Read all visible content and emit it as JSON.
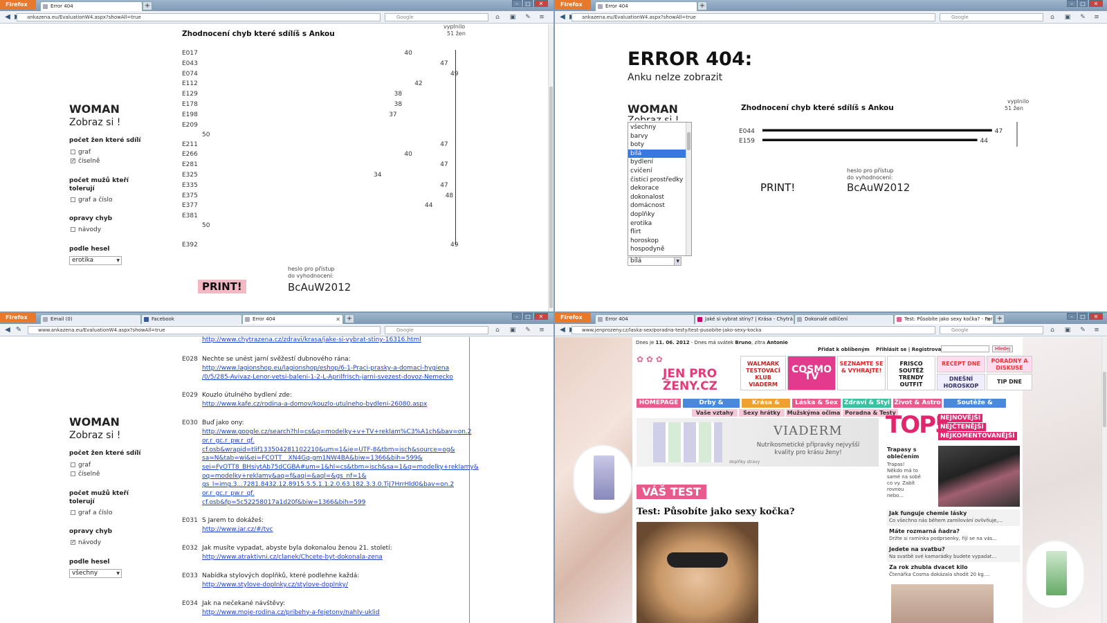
{
  "browser": {
    "ff_label": "Firefox",
    "tab_error": "Error 404",
    "tab_email": "Email (0)",
    "tab_facebook": "Facebook",
    "tab_jaky": "Jaké si vybrat stíny? | Krása - Chytrá ž...",
    "tab_dokonale": "Dokonalé odlíčení",
    "tab_test": "Test: Působíte jako sexy kočka? - Pora...",
    "url_anka": "ankazena.eu/EvaluationW4.aspx?showAll=true",
    "url_anka_www": "www.ankazena.eu/EvaluationW4.aspx?showAll=true",
    "url_jen": "www.jenprozeny.cz/laska-sex/poradna-testy/test-pusobite-jako-sexy-kocka",
    "search_engine": "Google"
  },
  "sidebar": {
    "woman": "WOMAN",
    "zobraz": "Zobraz si !",
    "pocet_zen": "počet žen které sdílí",
    "graf": "graf",
    "ciselne": "číselně",
    "pocet_muzu": "počet mužů kteří",
    "toleruji": "tolerují",
    "graf_cislo": "graf a číslo",
    "opravy": "opravy chyb",
    "navody": "návody",
    "podle_hesel": "podle hesel",
    "select_q1": "erotika",
    "select_q3": "všechny"
  },
  "q1": {
    "title": "Zhodnocení chyb které sdílíš s Ankou",
    "vyplnilo": "vyplnilo",
    "zen": "51 žen",
    "rows": [
      {
        "code": "E017",
        "value": "40"
      },
      {
        "code": "E043",
        "value": "47"
      },
      {
        "code": "E074",
        "value": "49"
      },
      {
        "code": "E112",
        "value": "42"
      },
      {
        "code": "E129",
        "value": "38"
      },
      {
        "code": "E178",
        "value": "38"
      },
      {
        "code": "E198",
        "value": "37"
      },
      {
        "code": "E209",
        "value": "50"
      },
      {
        "code": "E211",
        "value": "47"
      },
      {
        "code": "E266",
        "value": "40"
      },
      {
        "code": "E281",
        "value": "47"
      },
      {
        "code": "E325",
        "value": "34"
      },
      {
        "code": "E335",
        "value": "47"
      },
      {
        "code": "E375",
        "value": "48"
      },
      {
        "code": "E377",
        "value": "44"
      },
      {
        "code": "E381",
        "value": "50"
      },
      {
        "code": "E392",
        "value": "49"
      }
    ],
    "print": "PRINT!",
    "heslo1": "heslo pro přístup",
    "heslo2": "do vyhodnocení:",
    "password": "BcAuW2012"
  },
  "q2": {
    "error": "ERROR 404:",
    "error_sub": "Anku nelze zobrazit",
    "woman": "WOMAN",
    "zobraz_partial": "Zobraz si !",
    "title": "Zhodnocení chyb které sdílíš s Ankou",
    "vyplnilo": "vyplnilo",
    "zen": "51 žen",
    "chart_data": {
      "type": "bar",
      "orientation": "horizontal",
      "categories": [
        "E044",
        "E159"
      ],
      "values": [
        47,
        44
      ],
      "xlim": [
        0,
        51
      ]
    },
    "listbox": [
      "všechny",
      "barvy",
      "boty",
      "bílá",
      "bydlení",
      "cvičení",
      "čisticí prostředky",
      "dekorace",
      "dokonalost",
      "domácnost",
      "doplňky",
      "erotika",
      "flirt",
      "horoskop",
      "hospodyně"
    ],
    "listbox_selected": "bílá",
    "select_value": "bílá",
    "print": "PRINT!",
    "heslo1": "heslo pro přístup",
    "heslo2": "do vyhodnocení:",
    "password": "BcAuW2012"
  },
  "q3": {
    "top_link": "http://www.chytrazena.cz/zdravi/krasa/jake-si-vybrat-stiny-16316.html",
    "items": [
      {
        "code": "E028",
        "text": "Nechte se unést jarní svěžestí dubnového rána:",
        "links": [
          "http://www.lagionshop.eu/lagionshop/eshop/6-1-Praci-prasky-a-domaci-hygiena",
          "/0/5/285-Avivaz-Lenor-vetsi-baleni-1-2-L-Aprilfrisch-jarni-svezest-dovoz-Nemecko"
        ]
      },
      {
        "code": "E029",
        "text": "Kouzlo útulného bydlení zde:",
        "links": [
          "http://www.kafe.cz/rodina-a-domov/kouzlo-utulneho-bydleni-26080.aspx"
        ]
      },
      {
        "code": "E030",
        "text": "Buď jako ony:",
        "links": [
          "http://www.google.cz/search?hl=cs&q=modelky+v+TV+reklam%C3%A1ch&bav=on.2",
          "or.r_gc.r_pw.r_qf.",
          "cf.osb&wrapid=tlif133504281102210&um=1&ie=UTF-8&tbm=isch&source=og&",
          "sa=N&tab=wi&ei=FCOTT__XN4Gq-gm1NW4BA&biw=1366&bih=599&",
          "sei=FyOTT8_BHsiytAb75dCGBA#um=1&hl=cs&tbm=isch&sa=1&q=modelky+reklamy&",
          "oq=modelky+reklamy&aq=f&aqi=&aql=&gs_nf=1&",
          "gs_l=img.3...7281.8432.12.8915.5.5.1.1.2.0.63.182.3.3.0.TiJ7HrrHld0&bav=on.2",
          "or.r_gc.r_pw.r_qf.",
          "cf.osb&fp=5c52258017a1d20f&biw=1366&bih=599"
        ]
      },
      {
        "code": "E031",
        "text": "S Jarem to dokážeš:",
        "links": [
          "http://www.jar.cz/#/tvc"
        ]
      },
      {
        "code": "E032",
        "text": "Jak musíte vypadat, abyste byla dokonalou ženou 21. století:",
        "links": [
          "http://www.atraktivni.cz/clanek/Chcete-byt-dokonala-zena"
        ]
      },
      {
        "code": "E033",
        "text": "Nabídka stylových doplňků, které podlehne každá:",
        "links": [
          "http://www.stylove-doplnky.cz/stylove-doplnky/"
        ]
      },
      {
        "code": "E034",
        "text": "Jak na nečekané návštěvy:",
        "links": [
          "http://www.moje-rodina.cz/pribehy-a-fejetony/nahly-uklid"
        ]
      }
    ]
  },
  "q4": {
    "date_prefix": "Dnes je",
    "date": "11. 06. 2012",
    "date_mid": "- Dnes má svátek",
    "svatek": "Bruno",
    "zitra": ", zítra",
    "zitra_name": "Antonie",
    "pridat": "Přidat k oblíbeným",
    "prihlasit": "Přihlásit se | Registrovat",
    "hledej": "Hledej",
    "logo1": "JEN PRO",
    "logo2": "ŽENY.CZ",
    "ads": [
      "WALMARK TESTOVACÍ KLUB VIADERM",
      "COSMO TV",
      "SEZNAMTE SE & VYHRAJTE!",
      "FRISCO SOUTĚŽ TRENDY OUTFIT",
      "RECEPT DNE",
      "PORADNY A DISKUSE",
      "DNEŠNÍ HOROSKOP",
      "TIP DNE"
    ],
    "nav": [
      "HOMEPAGE",
      "Drby & Celebrity",
      "Krása & Móda",
      "Láska & Sex",
      "Zdraví & Styl",
      "Život & Astro",
      "Soutěže & Kontakty"
    ],
    "subnav": [
      "Vaše vztahy",
      "Sexy hrátky",
      "Mužskýma očima",
      "Poradna & Testy"
    ],
    "banner_title": "VIADERM",
    "banner_text": "Nutrikosmetické přípravky nejvyšší kvality pro krásu ženy!",
    "banner_small": "doplňky stravy",
    "top5": "TOP5",
    "top5_tags": [
      "NEJNOVĚJŠÍ",
      "NEJČTENĚJŠÍ",
      "NEJKOMENTOVANĚJŠÍ"
    ],
    "top5_story_title": "Trapasy s oblečením",
    "top5_story": "Trapas! Někdo má to samé na sobě co vy. Zabít rovnou nebo...",
    "vas_test": "VÁŠ TEST",
    "test_title": "Test: Působíte jako sexy kočka?",
    "side": [
      {
        "t": "Jak funguje chemie lásky",
        "d": "Co všechno nás během zamilování ovlivňuje,..."
      },
      {
        "t": "Máte rozmarná ňadra?",
        "d": "Držte si ramínka podprsenky, říjí se na vás..."
      },
      {
        "t": "Jedete na svatbu?",
        "d": "Na svatbě své kamarádky budete vypadat..."
      },
      {
        "t": "Za rok zhubla dvacet kilo",
        "d": "Čtenářka Cosma dokázala shodit 20 kg...."
      }
    ]
  }
}
